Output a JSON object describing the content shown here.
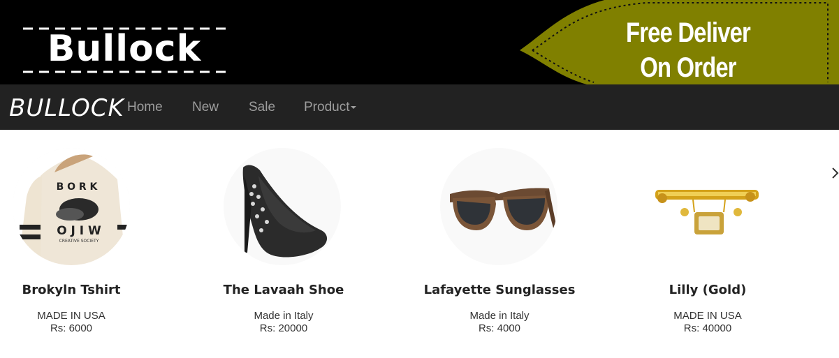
{
  "banner": {
    "logo_text": "Bullock",
    "promo_line1": "Free Deliver",
    "promo_line2": "On Order",
    "promo_color": "#808000"
  },
  "navbar": {
    "brand": "BULLOCK",
    "links": [
      "Home",
      "New",
      "Sale",
      "Product"
    ]
  },
  "products": [
    {
      "name": "Brokyln Tshirt",
      "origin": "MADE IN USA",
      "price": "Rs: 6000",
      "icon": "tshirt-image"
    },
    {
      "name": "The Lavaah Shoe",
      "origin": "Made in Italy",
      "price": "Rs: 20000",
      "icon": "shoe-image"
    },
    {
      "name": "Lafayette Sunglasses",
      "origin": "Made in Italy",
      "price": "Rs: 4000",
      "icon": "sunglasses-image"
    },
    {
      "name": "Lilly (Gold)",
      "origin": "MADE IN USA",
      "price": "Rs: 40000",
      "icon": "gold-watch-image"
    }
  ],
  "carousel": {
    "next_icon": "chevron-right-icon"
  }
}
